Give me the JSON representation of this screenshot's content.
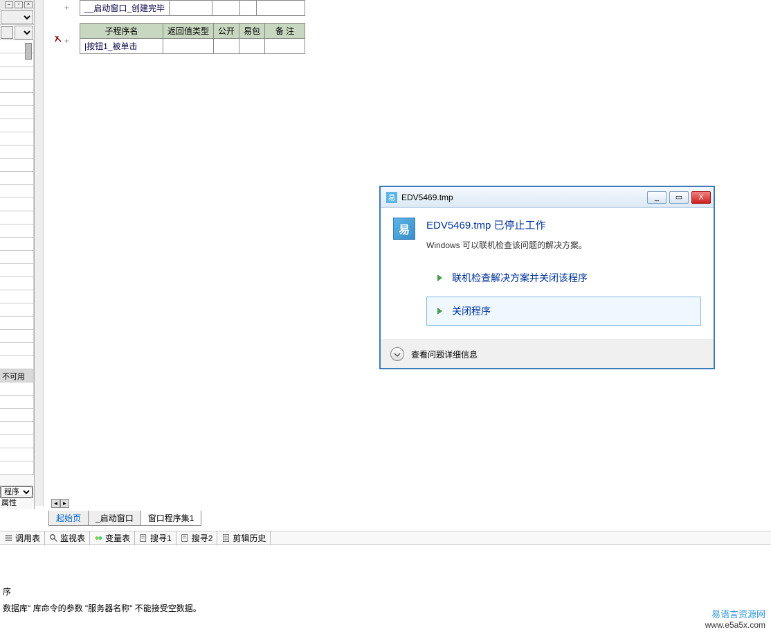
{
  "left_panel": {
    "unavailable_text": "不可用",
    "type_label": "程序",
    "bottom_label": "属性"
  },
  "code": {
    "table1_row": "__启动窗口_创建完毕",
    "table2_headers": [
      "子程序名",
      "返回值类型",
      "公开",
      "易包",
      "备 注"
    ],
    "table2_row": "|按钮1_被单击"
  },
  "tabs": {
    "start": "起始页",
    "window": "_启动窗口",
    "procset": "窗口程序集1"
  },
  "tooltabs": {
    "calltable": "调用表",
    "watch": "监视表",
    "vars": "变量表",
    "search1": "搜寻1",
    "search2": "搜寻2",
    "edithistory": "剪辑历史"
  },
  "log": {
    "line1": "序",
    "line2": "数据库\" 库命令的参数 \"服务器名称\" 不能接受空数据。"
  },
  "dialog": {
    "title": "EDV5469.tmp",
    "heading": "EDV5469.tmp 已停止工作",
    "subtext": "Windows 可以联机检查该问题的解决方案。",
    "option1": "联机检查解决方案并关闭该程序",
    "option2": "关闭程序",
    "details": "查看问题详细信息",
    "min": "_",
    "max": "▭",
    "close": "X",
    "appicon_glyph": "易"
  },
  "watermark": {
    "cn": "易语言资源网",
    "url": "www.e5a5x.com"
  }
}
